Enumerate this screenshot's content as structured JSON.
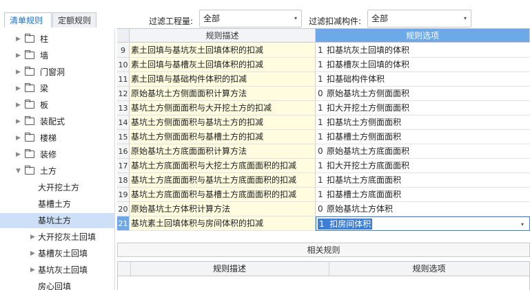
{
  "tabs": [
    {
      "label": "清单规则",
      "active": true
    },
    {
      "label": "定额规则",
      "active": false
    }
  ],
  "filters": {
    "project_label": "过滤工程量:",
    "project_value": "全部",
    "component_label": "过滤扣减构件:",
    "component_value": "全部"
  },
  "tree": {
    "categories": [
      "柱",
      "墙",
      "门窗洞",
      "梁",
      "板",
      "装配式",
      "楼梯",
      "装修",
      "土方"
    ],
    "earthwork_children": [
      "大开挖土方",
      "基槽土方",
      "基坑土方",
      "大开挖灰土回填",
      "基槽灰土回填",
      "基坑灰土回填",
      "房心回填"
    ]
  },
  "grid": {
    "header_desc": "规则描述",
    "header_option": "规则选项",
    "rows": [
      {
        "num": "9",
        "desc": "素土回填与基坑灰土回填体积的扣减",
        "val": "1",
        "opt": "扣基坑灰土回填的体积"
      },
      {
        "num": "10",
        "desc": "素土回填与基槽灰土回填体积的扣减",
        "val": "1",
        "opt": "扣基槽灰土回填的体积"
      },
      {
        "num": "11",
        "desc": "素土回填与基础构件体积的扣减",
        "val": "1",
        "opt": "扣基础构件体积"
      },
      {
        "num": "12",
        "desc": "原始基坑土方侧面面积计算方法",
        "val": "0",
        "opt": "原始基坑土方侧面面积"
      },
      {
        "num": "13",
        "desc": "基坑土方侧面面积与大开挖土方的扣减",
        "val": "1",
        "opt": "扣大开挖土方侧面面积"
      },
      {
        "num": "14",
        "desc": "基坑土方侧面面积与基坑土方的扣减",
        "val": "1",
        "opt": "扣基坑土方侧面面积"
      },
      {
        "num": "15",
        "desc": "基坑土方侧面面积与基槽土方的扣减",
        "val": "1",
        "opt": "扣基槽土方侧面面积"
      },
      {
        "num": "16",
        "desc": "原始基坑土方底面面积计算方法",
        "val": "0",
        "opt": "原始基坑土方底面面积"
      },
      {
        "num": "17",
        "desc": "基坑土方底面面积与大挖土方底面面积的扣减",
        "val": "1",
        "opt": "扣大开挖土方底面面积"
      },
      {
        "num": "18",
        "desc": "基坑土方底面面积与基坑土方底面面积的扣减",
        "val": "1",
        "opt": "扣基坑土方底面面积"
      },
      {
        "num": "19",
        "desc": "基坑土方底面面积与基槽土方底面面积的扣减",
        "val": "1",
        "opt": "扣基槽土方底面面积"
      },
      {
        "num": "20",
        "desc": "原始基坑土方体积计算方法",
        "val": "0",
        "opt": "原始基坑土方体积"
      },
      {
        "num": "21",
        "desc": "基坑素土回填体积与房间体积的扣减",
        "val": "1",
        "opt": "扣房间体积"
      }
    ]
  },
  "related": {
    "title": "相关规则",
    "header_desc": "规则描述",
    "header_option": "规则选项"
  },
  "colors": {
    "accent": "#6da8e8",
    "selection": "#3d7fd6",
    "desc_cell_bg": "#fffce0",
    "tree_selected": "#cde0f7"
  }
}
